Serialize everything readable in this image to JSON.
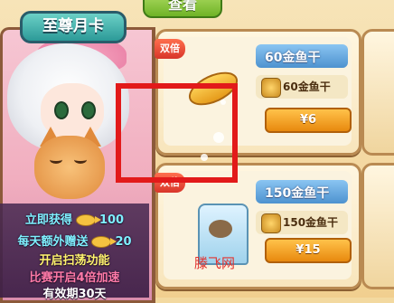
{
  "header": {
    "top_button": "查看"
  },
  "monthly_card": {
    "title": "至尊月卡",
    "lines": {
      "l1": {
        "text": "立即获得",
        "amount": "100"
      },
      "l2": {
        "text": "每天额外赠送",
        "amount": "20"
      },
      "l3": "开启扫荡功能",
      "l4": "比赛开启4倍加速",
      "l5": "有效期30天"
    }
  },
  "products": [
    {
      "tag": "双倍",
      "title": "60金鱼干",
      "detail": "60金鱼干",
      "price": "¥6"
    },
    {
      "tag": "双倍",
      "title": "150金鱼干",
      "detail": "150金鱼干",
      "price": "¥15"
    }
  ],
  "watermark": "滕飞网",
  "colors": {
    "accent_red": "#e21a1a",
    "price_orange": "#e8890e",
    "title_blue": "#4d92cf"
  }
}
